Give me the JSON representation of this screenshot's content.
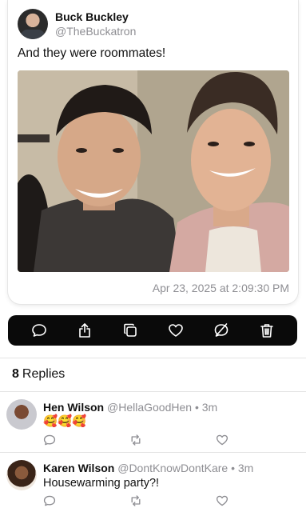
{
  "post": {
    "author_name": "Buck Buckley",
    "author_handle": "@TheBuckatron",
    "text": "And they were roommates!",
    "timestamp": "Apr 23, 2025 at 2:09:30 PM"
  },
  "actions": [
    {
      "icon": "reply-icon"
    },
    {
      "icon": "share-icon"
    },
    {
      "icon": "copy-icon"
    },
    {
      "icon": "heart-icon"
    },
    {
      "icon": "mute-icon"
    },
    {
      "icon": "trash-icon"
    }
  ],
  "replies_header": {
    "count": "8",
    "label": "Replies"
  },
  "replies": [
    {
      "name": "Hen Wilson",
      "handle": "@HellaGoodHen",
      "sep": "•",
      "time": "3m",
      "body": "🥰🥰🥰"
    },
    {
      "name": "Karen Wilson",
      "handle": "@DontKnowDontKare",
      "sep": "•",
      "time": "3m",
      "body": "Housewarming party?!"
    }
  ],
  "colors": {
    "action_bar_bg": "#0a0a0a",
    "muted_text": "#8e8e93",
    "icon_gray": "#8e8e93"
  }
}
